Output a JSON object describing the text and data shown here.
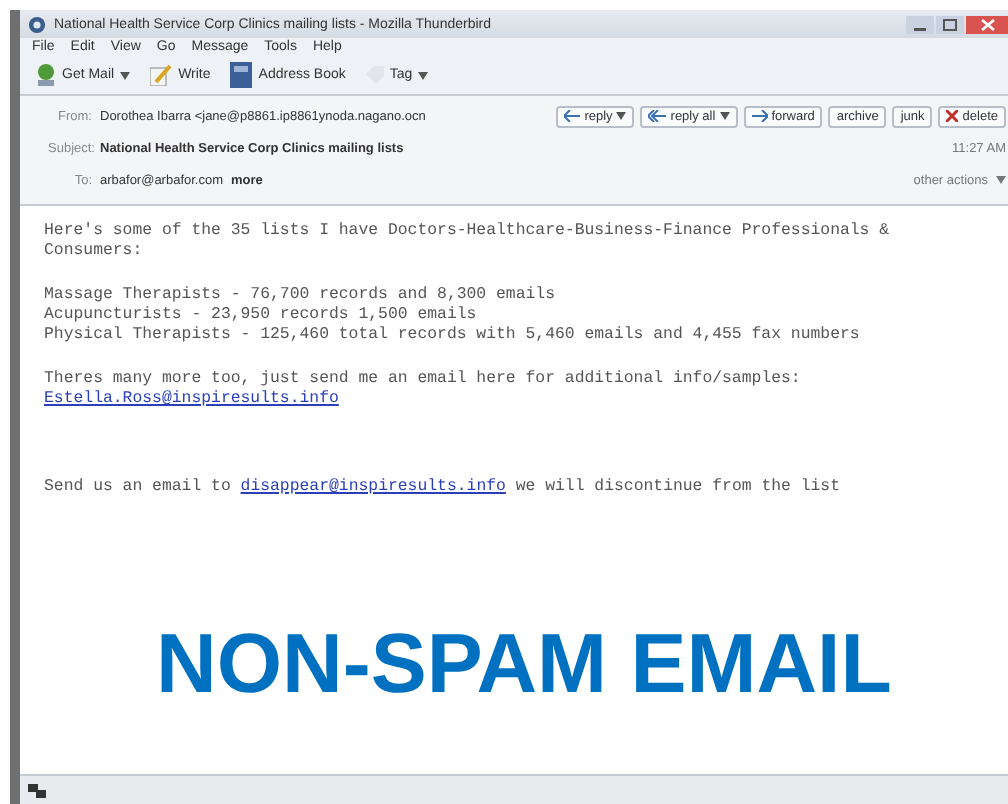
{
  "window": {
    "title": "National Health Service Corp Clinics mailing lists - Mozilla Thunderbird"
  },
  "menu": [
    "File",
    "Edit",
    "View",
    "Go",
    "Message",
    "Tools",
    "Help"
  ],
  "toolbar": [
    {
      "kind": "getmail",
      "label": "Get Mail",
      "dropdown": true
    },
    {
      "kind": "write",
      "label": "Write",
      "dropdown": false
    },
    {
      "kind": "addressbook",
      "label": "Address Book",
      "dropdown": false
    },
    {
      "kind": "tag",
      "label": "Tag",
      "dropdown": true
    }
  ],
  "header": {
    "from_label": "From:",
    "from": "Dorothea Ibarra <jane@p8861.ip8861ynoda.nagano.ocn",
    "subject_label": "Subject:",
    "subject": "National Health Service Corp Clinics mailing lists",
    "time": "11:27 AM",
    "to_label": "To:",
    "to": "arbafor@arbafor.com",
    "more": "more",
    "other_actions": "other actions",
    "actions": [
      {
        "kind": "reply",
        "label": "reply",
        "dropdown": true
      },
      {
        "kind": "replyall",
        "label": "reply all",
        "dropdown": true
      },
      {
        "kind": "forward",
        "label": "forward",
        "dropdown": false
      },
      {
        "kind": "plain",
        "label": "archive",
        "dropdown": false
      },
      {
        "kind": "plain",
        "label": "junk",
        "dropdown": false
      },
      {
        "kind": "delete",
        "label": "delete",
        "dropdown": false
      }
    ]
  },
  "body": [
    {
      "lines": [
        [
          {
            "text": "Here's some of the 35 lists I have Doctors-Healthcare-Business-Finance Professionals &"
          }
        ],
        [
          {
            "text": "Consumers:"
          }
        ]
      ]
    },
    {
      "lines": [
        [
          {
            "text": "Massage Therapists - 76,700 records and 8,300 emails"
          }
        ],
        [
          {
            "text": "Acupuncturists - 23,950 records 1,500 emails"
          }
        ],
        [
          {
            "text": "Physical Therapists - 125,460 total records with 5,460 emails and 4,455 fax numbers"
          }
        ]
      ]
    },
    {
      "lines": [
        [
          {
            "text": "Theres many more too, just send me an email here for additional info/samples:"
          }
        ],
        [
          {
            "text": "Estella.Ross@inspiresults.info",
            "link": true
          }
        ]
      ]
    },
    {
      "lines": [
        [
          {
            "text": "Send us an email to "
          },
          {
            "text": "disappear@inspiresults.info",
            "link": true
          },
          {
            "text": " we will discontinue from the list"
          }
        ]
      ]
    }
  ],
  "caption": "NON-SPAM EMAIL"
}
